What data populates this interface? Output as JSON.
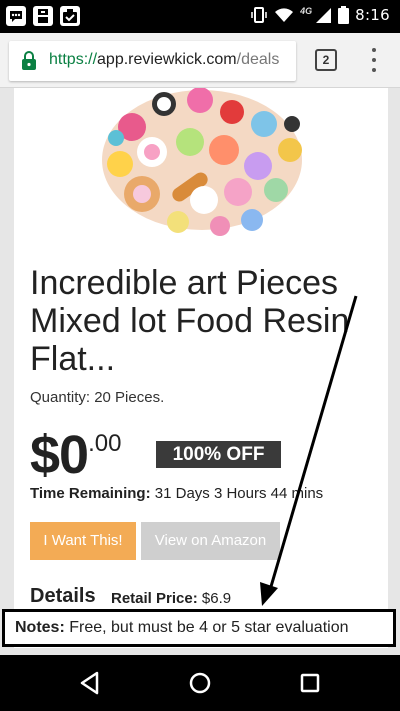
{
  "status_bar": {
    "time": "8:16",
    "network": "4G"
  },
  "browser": {
    "url_scheme": "https://",
    "url_host": "app.reviewkick.com",
    "url_path": "/deals",
    "tab_count": "2"
  },
  "product": {
    "title": "Incredible art Pieces Mixed lot Food Resin Flat...",
    "quantity": "Quantity: 20 Pieces.",
    "price_main": "$0",
    "price_cents": ".00",
    "discount_badge": "100% OFF",
    "time_remaining_label": "Time Remaining:",
    "time_remaining_value": "31 Days 3 Hours 44 mins",
    "want_button": "I Want This!",
    "amazon_button": "View on Amazon",
    "details_heading": "Details",
    "retail_label": "Retail Price:",
    "retail_value": "$6.9"
  },
  "annotation": {
    "notes_label": "Notes:",
    "notes_text": " Free, but must be 4 or 5 star evaluation"
  },
  "colors": {
    "want_button": "#f3ab55",
    "amazon_button": "#cfcfcf",
    "badge": "#3a3a3a",
    "secure_green": "#0b8043"
  },
  "icons": [
    "messenger-icon",
    "app-icon",
    "clipboard-check-icon",
    "vibrate-icon",
    "wifi-icon",
    "signal-icon",
    "battery-icon",
    "lock-icon",
    "tabs-icon",
    "overflow-menu-icon",
    "back-icon",
    "home-icon",
    "recents-icon"
  ]
}
